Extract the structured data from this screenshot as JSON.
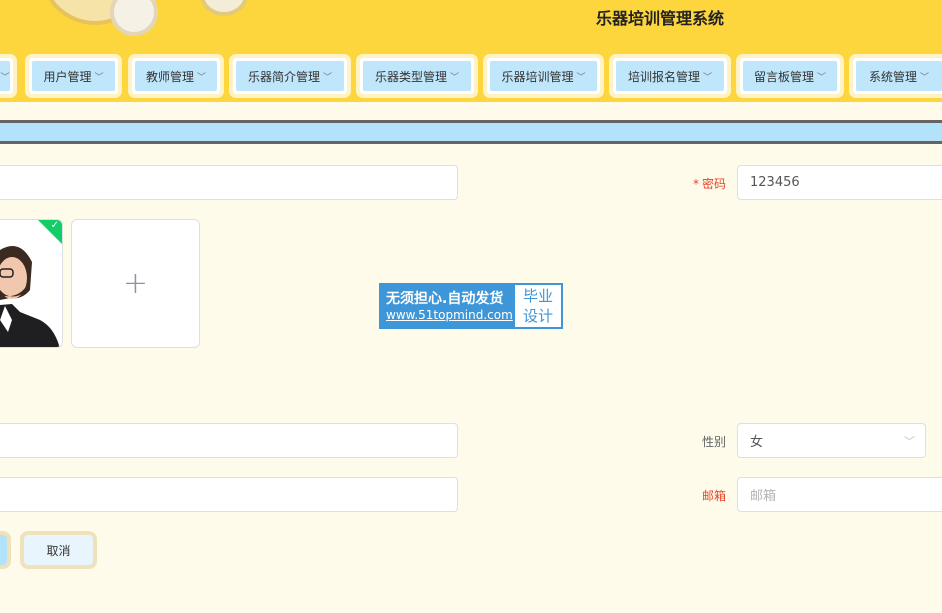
{
  "app": {
    "title": "乐器培训管理系统"
  },
  "nav": {
    "items": [
      {
        "label": "用户管理"
      },
      {
        "label": "教师管理"
      },
      {
        "label": "乐器简介管理"
      },
      {
        "label": "乐器类型管理"
      },
      {
        "label": "乐器培训管理"
      },
      {
        "label": "培训报名管理"
      },
      {
        "label": "留言板管理"
      },
      {
        "label": "系统管理"
      }
    ]
  },
  "form": {
    "password": {
      "label": "密码",
      "required_mark": "*",
      "value": "123456"
    },
    "gender": {
      "label": "性别",
      "value": "女"
    },
    "email": {
      "label": "邮箱",
      "placeholder": "邮箱"
    },
    "upload": {
      "plus": "+"
    }
  },
  "watermark": {
    "line1": "无须担心.自动发货",
    "line2": "www.51topmind.com",
    "right1": "毕业",
    "right2": "设计"
  },
  "buttons": {
    "cancel": "取消"
  },
  "colors": {
    "header_bg": "#fdd63d",
    "nav_item_bg": "#bfe6fb",
    "page_bg": "#fffbea",
    "required": "#e2462a",
    "success_badge": "#13ce66"
  }
}
